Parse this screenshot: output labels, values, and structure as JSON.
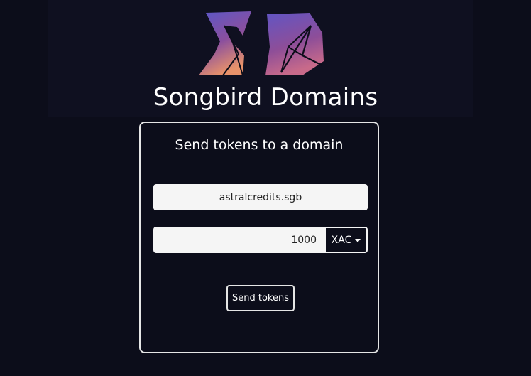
{
  "brand": {
    "title": "Songbird Domains",
    "logo_icon": "songbird-sd-logo-icon",
    "colors": {
      "gradient_top": "#5a58c8",
      "gradient_mid": "#8a4f9e",
      "gradient_bottom": "#e8926a"
    }
  },
  "form": {
    "title": "Send tokens to a domain",
    "domain_value": "astralcredits.sgb",
    "amount_value": "1000",
    "token_selected": "XAC",
    "token_caret_icon": "caret-down-icon",
    "send_label": "Send tokens"
  },
  "theme": {
    "background": "#0c0d1a",
    "input_background": "#f5f5f5",
    "border": "#e6e6e6"
  }
}
